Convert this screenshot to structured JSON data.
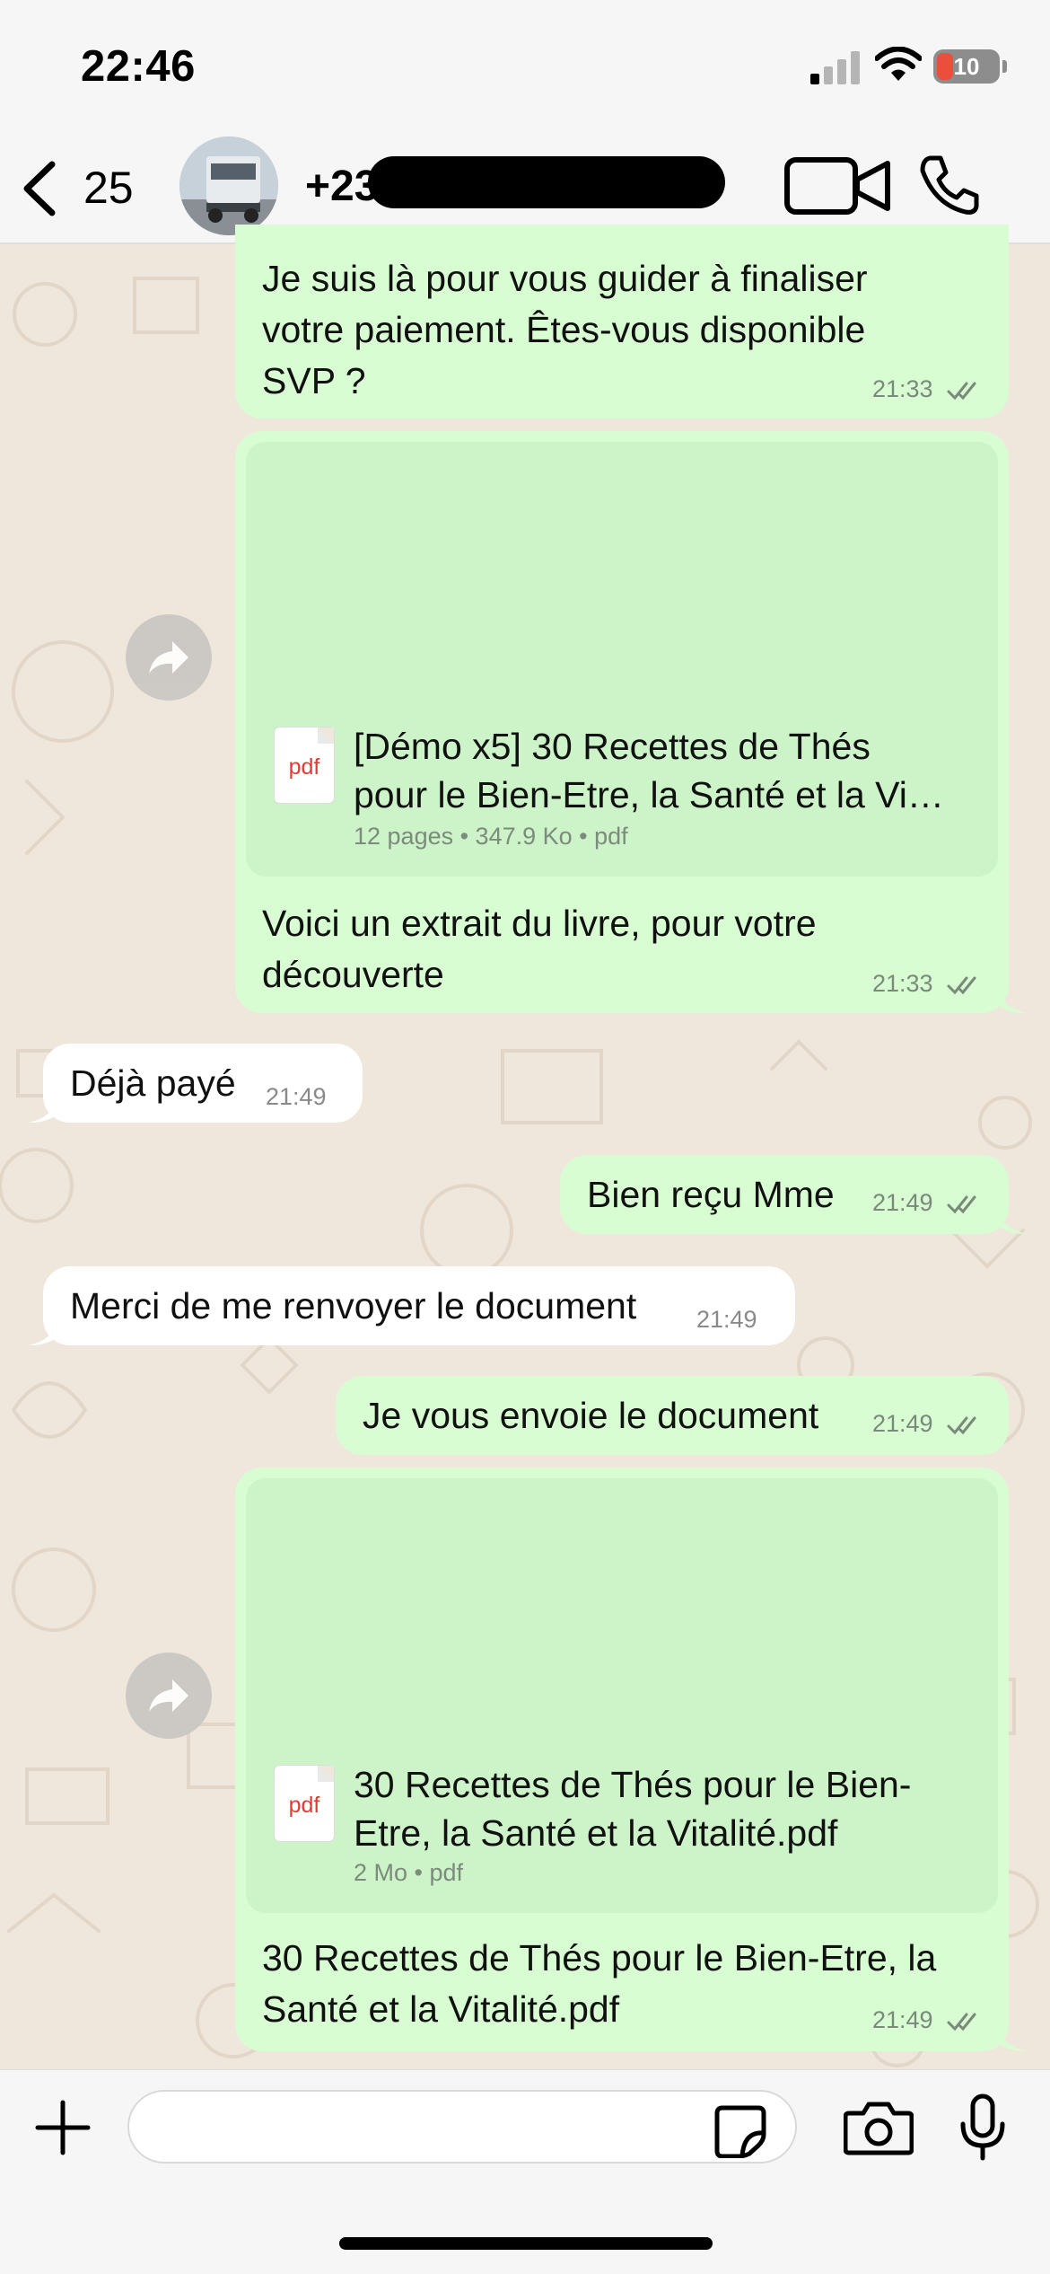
{
  "status": {
    "time": "22:46",
    "battery": "10",
    "icons": [
      "signal-icon",
      "wifi-icon",
      "battery-icon"
    ]
  },
  "header": {
    "back_count": "25",
    "contact_name": "+23",
    "icons": [
      "back-chevron-icon",
      "avatar",
      "video-call-icon",
      "phone-call-icon"
    ]
  },
  "messages": [
    {
      "direction": "out",
      "text_lines": [
        "Je suis là pour vous guider à finaliser",
        "votre paiement. Êtes-vous disponible",
        "SVP ?"
      ],
      "time": "21:33",
      "status": "read"
    },
    {
      "direction": "out",
      "type": "document",
      "doc_title_lines": [
        "[Démo x5] 30 Recettes de Thés",
        "pour le Bien-Etre, la Santé et la Vi…"
      ],
      "doc_meta": "12 pages • 347.9 Ko • pdf",
      "pdf_label": "pdf",
      "caption_lines": [
        "Voici un extrait du livre, pour votre",
        "découverte"
      ],
      "time": "21:33",
      "status": "read"
    },
    {
      "direction": "in",
      "text": "Déjà payé",
      "time": "21:49"
    },
    {
      "direction": "out",
      "text": "Bien reçu Mme",
      "time": "21:49",
      "status": "read"
    },
    {
      "direction": "in",
      "text": "Merci de me renvoyer le document",
      "time": "21:49"
    },
    {
      "direction": "out",
      "text": "Je vous envoie le document",
      "time": "21:49",
      "status": "read"
    },
    {
      "direction": "out",
      "type": "document",
      "doc_title_lines": [
        "30 Recettes de Thés pour le Bien-",
        "Etre, la Santé et la Vitalité.pdf"
      ],
      "doc_meta": "2 Mo • pdf",
      "pdf_label": "pdf",
      "caption_lines": [
        "30 Recettes de Thés pour le Bien-Etre, la",
        "Santé et la Vitalité.pdf"
      ],
      "time": "21:49",
      "status": "read"
    }
  ],
  "composer": {
    "value": "",
    "icons": [
      "plus-icon",
      "sticker-icon",
      "camera-icon",
      "microphone-icon"
    ]
  },
  "colors": {
    "outgoing_bubble": "#d9fdd3",
    "incoming_bubble": "#ffffff",
    "document_preview": "#cdf3c9",
    "wallpaper": "#efe7dc",
    "read_ticks": "#7a8a7a",
    "battery_low": "#eb4e3d"
  }
}
